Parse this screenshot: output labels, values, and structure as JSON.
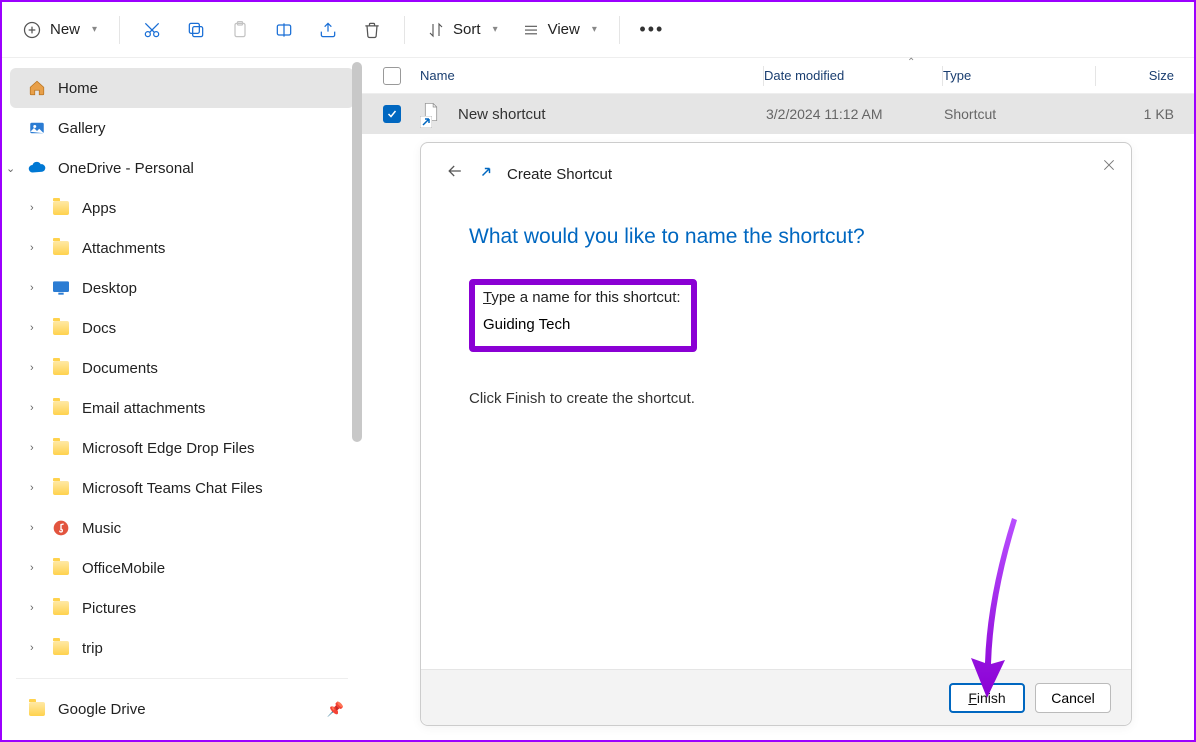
{
  "toolbar": {
    "new_label": "New",
    "sort_label": "Sort",
    "view_label": "View"
  },
  "sidebar": {
    "home": "Home",
    "gallery": "Gallery",
    "onedrive": "OneDrive - Personal",
    "folders": [
      "Apps",
      "Attachments",
      "Desktop",
      "Docs",
      "Documents",
      "Email attachments",
      "Microsoft Edge Drop Files",
      "Microsoft Teams Chat Files",
      "Music",
      "OfficeMobile",
      "Pictures",
      "trip"
    ],
    "google_drive": "Google Drive"
  },
  "columns": {
    "name": "Name",
    "date": "Date modified",
    "type": "Type",
    "size": "Size"
  },
  "row": {
    "name": "New shortcut",
    "date": "3/2/2024 11:12 AM",
    "type": "Shortcut",
    "size": "1 KB"
  },
  "dialog": {
    "title": "Create Shortcut",
    "question": "What would you like to name the shortcut?",
    "label": "Type a name for this shortcut:",
    "value": "Guiding Tech",
    "hint": "Click Finish to create the shortcut.",
    "finish": "Finish",
    "cancel": "Cancel"
  }
}
